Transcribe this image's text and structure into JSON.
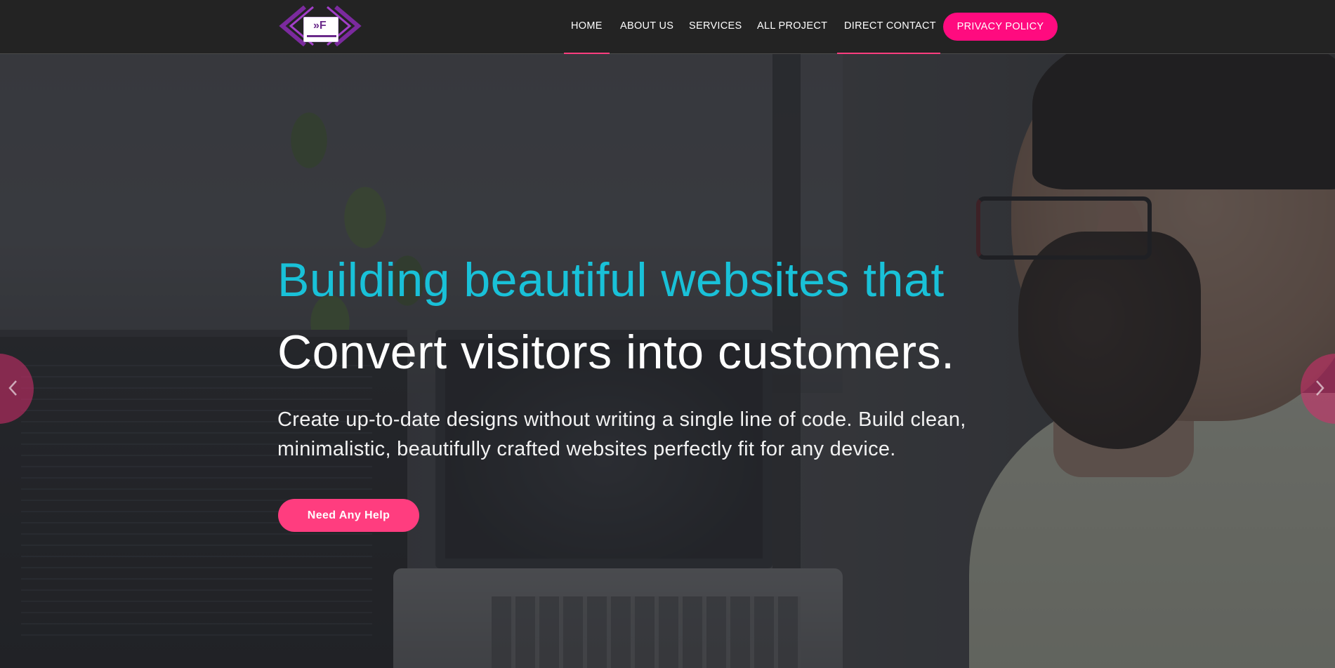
{
  "brand": {
    "logo_name": "brand-logo",
    "logo_small_text": "",
    "primary_color": "#ff0b7f",
    "accent_color": "#ff3d7f",
    "headline_color": "#19c1d8",
    "header_bg": "#232323"
  },
  "nav": {
    "items": [
      {
        "label": "HOME",
        "active": true
      },
      {
        "label": "ABOUT US",
        "active": false
      },
      {
        "label": "SERVICES",
        "active": false
      },
      {
        "label": "ALL PROJECT",
        "active": false
      },
      {
        "label": "DIRECT CONTACT",
        "active": true
      }
    ],
    "cta_label": "PRIVACY POLICY"
  },
  "hero": {
    "headline_line1": "Building beautiful websites that",
    "headline_line2": "Convert visitors into customers.",
    "subtext": "Create up-to-date designs without writing a single line of code. Build clean, minimalistic, beautifully crafted websites perfectly fit for any device.",
    "button_label": "Need Any Help",
    "prev_icon": "chevron-left-icon",
    "next_icon": "chevron-right-icon"
  }
}
